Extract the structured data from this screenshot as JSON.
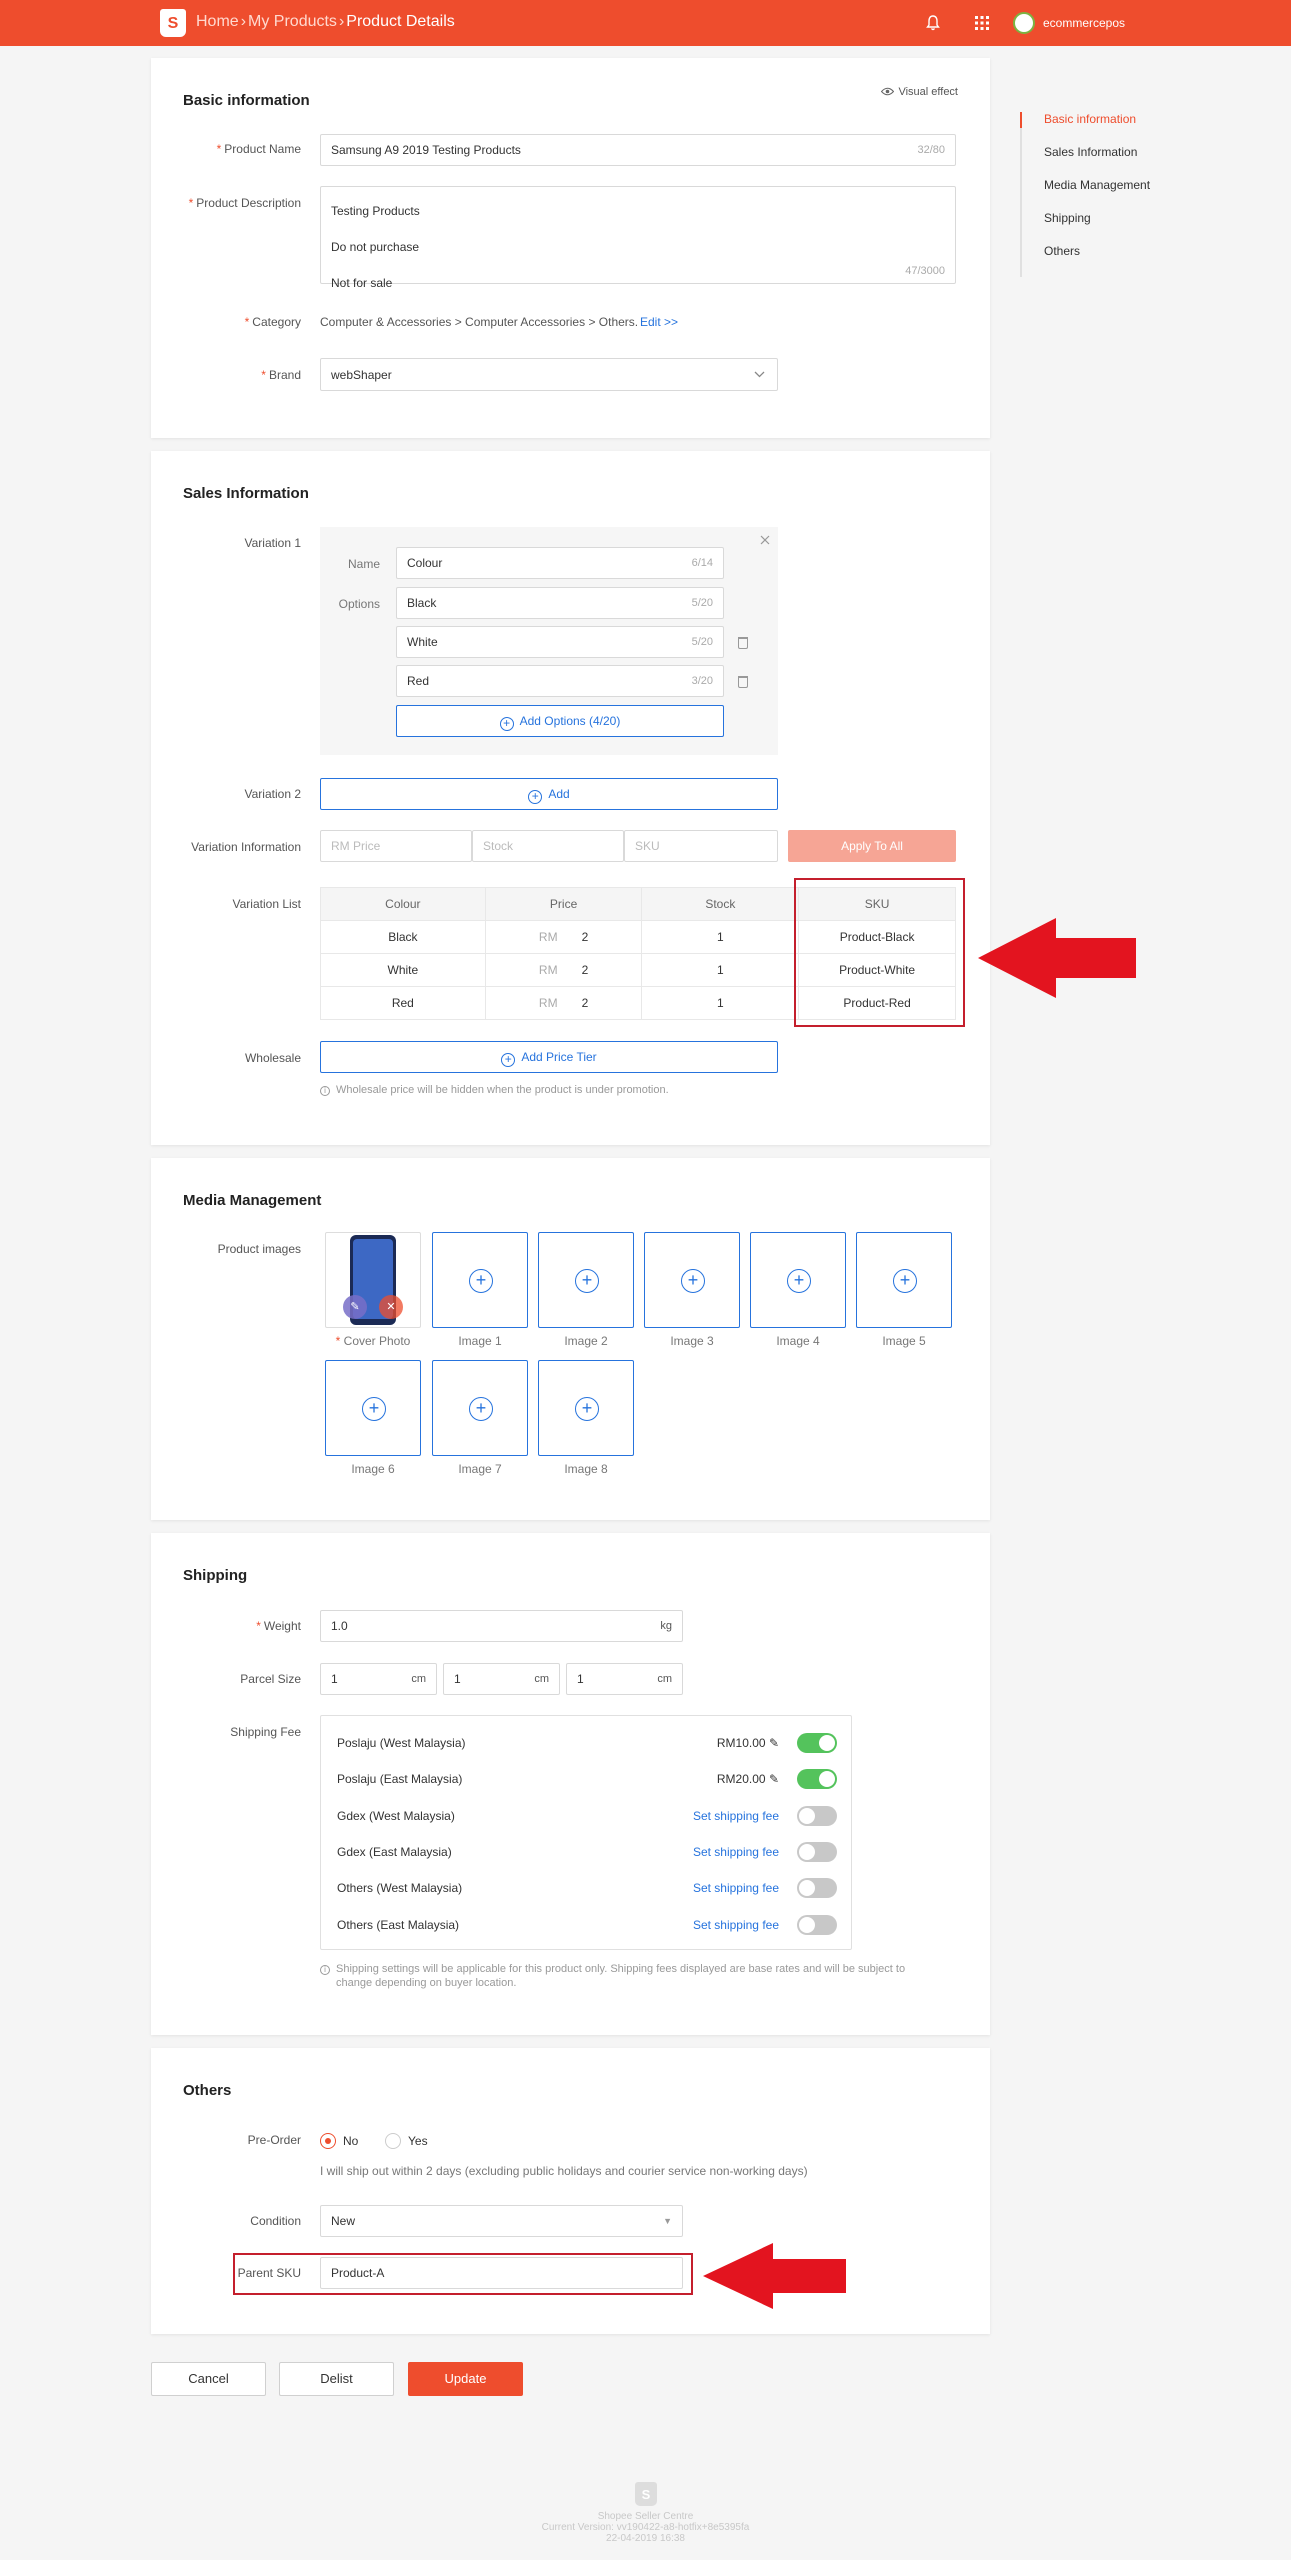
{
  "header": {
    "breadcrumb": [
      "Home",
      "My Products",
      "Product Details"
    ],
    "user_name": "ecommercepos",
    "icons": [
      "shopee-logo",
      "bell-icon",
      "apps-grid-icon",
      "avatar"
    ]
  },
  "sidenav": {
    "items": [
      "Basic information",
      "Sales Information",
      "Media Management",
      "Shipping",
      "Others"
    ],
    "active": "Basic information"
  },
  "basic": {
    "title": "Basic information",
    "visual_effect": "Visual effect",
    "product_name_label": "Product Name",
    "product_name_value": "Samsung A9 2019 Testing Products",
    "product_name_count": "32/80",
    "description_label": "Product Description",
    "description_lines": [
      "Testing Products",
      "Do not purchase",
      "Not for sale"
    ],
    "description_count": "47/3000",
    "category_label": "Category",
    "category_value": "Computer & Accessories > Computer Accessories > Others.",
    "category_edit": "Edit >>",
    "brand_label": "Brand",
    "brand_value": "webShaper"
  },
  "sales": {
    "title": "Sales Information",
    "variation1_label": "Variation 1",
    "name_label": "Name",
    "name_value": "Colour",
    "name_count": "6/14",
    "options_label": "Options",
    "options": [
      {
        "value": "Black",
        "count": "5/20"
      },
      {
        "value": "White",
        "count": "5/20"
      },
      {
        "value": "Red",
        "count": "3/20"
      }
    ],
    "add_options": "Add Options (4/20)",
    "variation2_label": "Variation 2",
    "variation2_add": "Add",
    "variation_info_label": "Variation Information",
    "price_placeholder": "RM Price",
    "stock_placeholder": "Stock",
    "sku_placeholder": "SKU",
    "apply_all": "Apply To All",
    "variation_list_label": "Variation List",
    "table_headers": [
      "Colour",
      "Price",
      "Stock",
      "SKU"
    ],
    "currency": "RM",
    "rows": [
      {
        "colour": "Black",
        "price": "2",
        "stock": "1",
        "sku": "Product-Black"
      },
      {
        "colour": "White",
        "price": "2",
        "stock": "1",
        "sku": "Product-White"
      },
      {
        "colour": "Red",
        "price": "2",
        "stock": "1",
        "sku": "Product-Red"
      }
    ],
    "wholesale_label": "Wholesale",
    "add_price_tier": "Add Price Tier",
    "wholesale_note": "Wholesale price will be hidden when the product is under promotion."
  },
  "media": {
    "title": "Media Management",
    "product_images_label": "Product images",
    "cover_caption": "Cover Photo",
    "captions": [
      "Image 1",
      "Image 2",
      "Image 3",
      "Image 4",
      "Image 5",
      "Image 6",
      "Image 7",
      "Image 8"
    ]
  },
  "shipping": {
    "title": "Shipping",
    "weight_label": "Weight",
    "weight_value": "1.0",
    "weight_unit": "kg",
    "parcel_label": "Parcel Size",
    "parcel_values": [
      "1",
      "1",
      "1"
    ],
    "parcel_unit": "cm",
    "fee_label": "Shipping Fee",
    "channels": [
      {
        "name": "Poslaju (West Malaysia)",
        "fee": "RM10.00",
        "on": true
      },
      {
        "name": "Poslaju (East Malaysia)",
        "fee": "RM20.00",
        "on": true
      },
      {
        "name": "Gdex (West Malaysia)",
        "fee": "Set shipping fee",
        "on": false
      },
      {
        "name": "Gdex (East Malaysia)",
        "fee": "Set shipping fee",
        "on": false
      },
      {
        "name": "Others (West Malaysia)",
        "fee": "Set shipping fee",
        "on": false
      },
      {
        "name": "Others (East Malaysia)",
        "fee": "Set shipping fee",
        "on": false
      }
    ],
    "note_line1": "Shipping settings will be applicable for this product only. Shipping fees displayed are base rates and will be subject to",
    "note_line2": "change depending on buyer location."
  },
  "others": {
    "title": "Others",
    "preorder_label": "Pre-Order",
    "no": "No",
    "yes": "Yes",
    "preorder_selected": "No",
    "ship_note": "I will ship out within 2 days (excluding public holidays and courier service non-working days)",
    "condition_label": "Condition",
    "condition_value": "New",
    "parent_sku_label": "Parent SKU",
    "parent_sku_value": "Product-A"
  },
  "actions": {
    "cancel": "Cancel",
    "delist": "Delist",
    "update": "Update"
  },
  "footer": {
    "line1": "Shopee Seller Centre",
    "line2": "Current Version: vv190422-a8-hotfix+8e5395fa",
    "line3": "22-04-2019 16:38"
  },
  "colors": {
    "brand": "#ee4d2d",
    "link": "#2673dd",
    "toggle_on": "#54c35c",
    "annotation": "#e3141f"
  }
}
